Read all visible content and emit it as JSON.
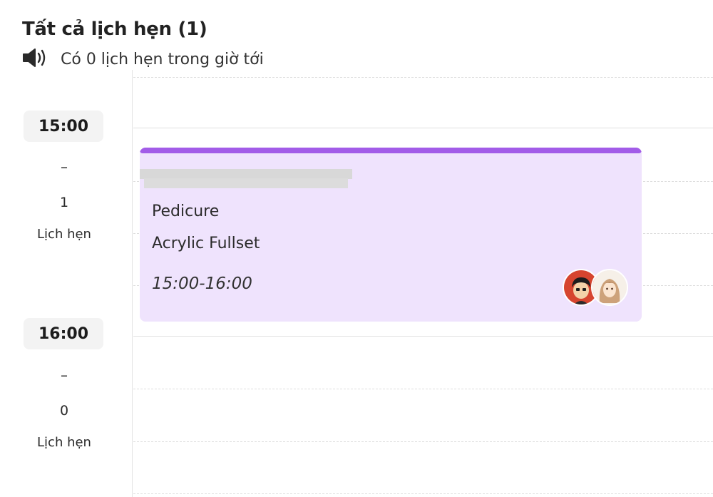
{
  "header": {
    "title": "Tất cả lịch hẹn (1)",
    "notice": "Có 0 lịch hẹn trong giờ tới",
    "notice_icon": "speaker-icon"
  },
  "time_slots": [
    {
      "time": "15:00",
      "dash": "–",
      "count": "1",
      "label": "Lịch hẹn"
    },
    {
      "time": "16:00",
      "dash": "–",
      "count": "0",
      "label": "Lịch hẹn"
    }
  ],
  "appointment": {
    "services": [
      "Pedicure",
      "Acrylic Fullset"
    ],
    "time_range": "15:00-16:00",
    "accent_color": "#a25ce8",
    "background_color": "#efe3fd",
    "staff_avatars": [
      "avatar-male-cartoon",
      "avatar-female-cartoon"
    ]
  }
}
